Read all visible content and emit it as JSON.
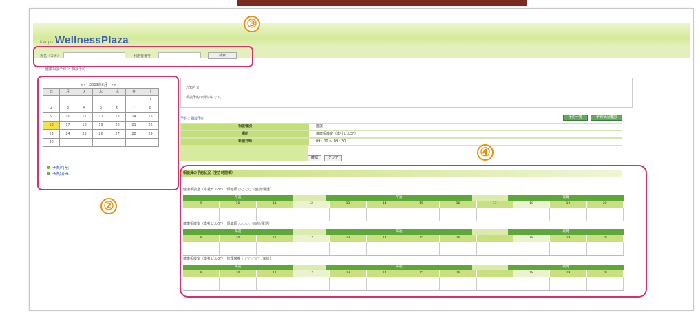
{
  "app": {
    "logo": "WellnessPlaza",
    "logo_prefix": "Kenpo"
  },
  "search": {
    "label1": "氏名（カナ）",
    "label2": "利用者番号",
    "button": "検索"
  },
  "breadcrumb": "健康相談予約 ＞ 相談予約",
  "calendar": {
    "title": "2013年6月",
    "prev": "<<",
    "next": ">>",
    "weekdays": [
      "日",
      "月",
      "火",
      "水",
      "木",
      "金",
      "土"
    ],
    "weeks": [
      [
        "",
        "",
        "",
        "",
        "",
        "",
        "1"
      ],
      [
        "2",
        "3",
        "4",
        "5",
        "6",
        "7",
        "8"
      ],
      [
        "9",
        "10",
        "11",
        "12",
        "13",
        "14",
        "15"
      ],
      [
        "16",
        "17",
        "18",
        "19",
        "20",
        "21",
        "22"
      ],
      [
        "23",
        "24",
        "25",
        "26",
        "27",
        "28",
        "29"
      ],
      [
        "30",
        "",
        "",
        "",
        "",
        "",
        ""
      ]
    ],
    "today": "16",
    "legend": [
      "予約可能",
      "予約済み"
    ]
  },
  "info": {
    "line1": "お知らせ",
    "line2": "相談予約の受付中です。"
  },
  "reservation": {
    "title": "予約：相談予約",
    "btn1": "予約一覧",
    "btn2": "予約状況確認",
    "rows": [
      {
        "label": "相談種別",
        "value": "面談"
      },
      {
        "label": "場所",
        "value": "健康相談室（本社ビル3F）"
      },
      {
        "label": "希望日時",
        "value": "09 : 00 ～ 09 : 30"
      }
    ],
    "submit": "確認",
    "clear": "クリア"
  },
  "schedule": {
    "title": "相談員の予約状況（空き時間帯）",
    "groups": [
      {
        "title": "健康相談室（本社ビル3F）：保健師 ○○ ○○（面談/電話）"
      },
      {
        "title": "健康相談室（本社ビル3F）：保健師 △△ △△（面談/電話）"
      },
      {
        "title": "健康相談室（本社ビル3F）：管理栄養士 □□ □□（面談）"
      }
    ],
    "bars": [
      "午前",
      "",
      "午後",
      "",
      "夜間"
    ],
    "cells": [
      "9",
      "10",
      "11",
      "12",
      "13",
      "14",
      "15",
      "16",
      "17",
      "18",
      "19",
      "20"
    ]
  },
  "callouts": {
    "n2": "②",
    "n3": "③",
    "n4": "④"
  }
}
